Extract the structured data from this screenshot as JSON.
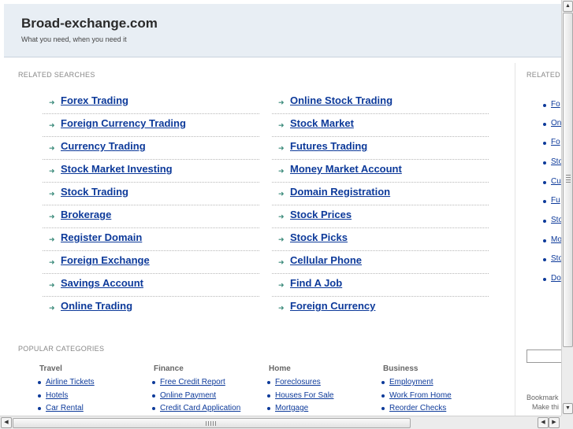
{
  "header": {
    "site_title": "Broad-exchange.com",
    "tagline": "What you need, when you need it"
  },
  "related_searches": {
    "heading": "RELATED SEARCHES",
    "left": [
      "Forex Trading",
      "Foreign Currency Trading",
      "Currency Trading",
      "Stock Market Investing",
      "Stock Trading",
      "Brokerage",
      "Register Domain",
      "Foreign Exchange",
      "Savings Account",
      "Online Trading"
    ],
    "right": [
      "Online Stock Trading",
      "Stock Market",
      "Futures Trading",
      "Money Market Account",
      "Domain Registration",
      "Stock Prices",
      "Stock Picks",
      "Cellular Phone",
      "Find A Job",
      "Foreign Currency"
    ]
  },
  "popular_categories": {
    "heading": "POPULAR CATEGORIES",
    "columns": [
      {
        "title": "Travel",
        "links": [
          "Airline Tickets",
          "Hotels",
          "Car Rental"
        ]
      },
      {
        "title": "Finance",
        "links": [
          "Free Credit Report",
          "Online Payment",
          "Credit Card Application"
        ]
      },
      {
        "title": "Home",
        "links": [
          "Foreclosures",
          "Houses For Sale",
          "Mortgage"
        ]
      },
      {
        "title": "Business",
        "links": [
          "Employment",
          "Work From Home",
          "Reorder Checks"
        ]
      }
    ]
  },
  "sidebar": {
    "heading": "RELATED",
    "links": [
      "Fo",
      "On",
      "Fo",
      "Sto",
      "Cu",
      "Fu",
      "Sto",
      "Mo",
      "Sto",
      "Do"
    ],
    "bookmark_text": "Bookmark",
    "make_this_text": "Make thi"
  },
  "colors": {
    "header_bg": "#e8eef4",
    "link": "#0d3a9a",
    "arrow": "#3a8a7a"
  },
  "icons": {
    "rs_arrow": "arrow-right-icon",
    "scroll_up": "up-arrow-icon",
    "scroll_down": "down-arrow-icon",
    "scroll_left": "left-arrow-icon",
    "scroll_right": "right-arrow-icon"
  }
}
